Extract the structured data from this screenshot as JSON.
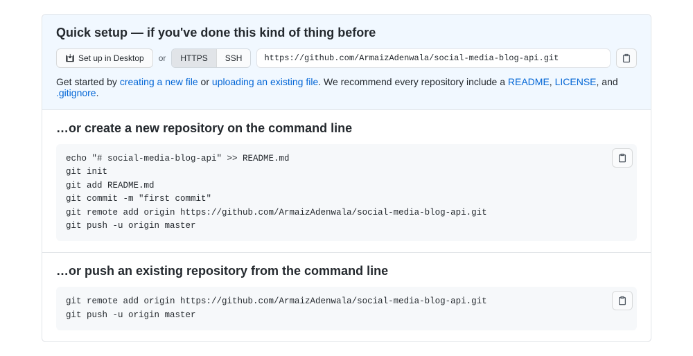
{
  "quickSetup": {
    "title": "Quick setup — if you've done this kind of thing before",
    "desktopBtn": "Set up in Desktop",
    "or": "or",
    "httpsLabel": "HTTPS",
    "sshLabel": "SSH",
    "cloneUrl": "https://github.com/ArmaizAdenwala/social-media-blog-api.git",
    "hintPrefix": "Get started by ",
    "linkCreate": "creating a new file",
    "hintOr": " or ",
    "linkUpload": "uploading an existing file",
    "hintMid": ". We recommend every repository include a ",
    "linkReadme": "README",
    "comma1": ", ",
    "linkLicense": "LICENSE",
    "comma2": ", and ",
    "linkGitignore": ".gitignore",
    "period": "."
  },
  "sectionCreate": {
    "title": "…or create a new repository on the command line",
    "code": "echo \"# social-media-blog-api\" >> README.md\ngit init\ngit add README.md\ngit commit -m \"first commit\"\ngit remote add origin https://github.com/ArmaizAdenwala/social-media-blog-api.git\ngit push -u origin master"
  },
  "sectionPush": {
    "title": "…or push an existing repository from the command line",
    "code": "git remote add origin https://github.com/ArmaizAdenwala/social-media-blog-api.git\ngit push -u origin master"
  }
}
